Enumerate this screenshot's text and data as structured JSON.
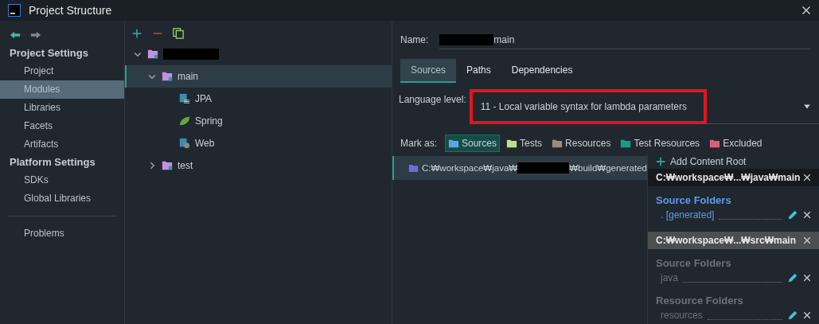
{
  "window": {
    "title": "Project Structure"
  },
  "sidebar": {
    "sections": [
      {
        "title": "Project Settings",
        "items": [
          {
            "label": "Project",
            "selected": false
          },
          {
            "label": "Modules",
            "selected": true
          },
          {
            "label": "Libraries",
            "selected": false
          },
          {
            "label": "Facets",
            "selected": false
          },
          {
            "label": "Artifacts",
            "selected": false
          }
        ]
      },
      {
        "title": "Platform Settings",
        "items": [
          {
            "label": "SDKs",
            "selected": false
          },
          {
            "label": "Global Libraries",
            "selected": false
          }
        ]
      }
    ],
    "bottom_items": [
      {
        "label": "Problems",
        "selected": false
      }
    ]
  },
  "tree": [
    {
      "redacted": true,
      "kind": "module",
      "expanded": true,
      "selected": false,
      "children": [
        {
          "label": "main",
          "kind": "module",
          "expanded": true,
          "selected": true,
          "children": [
            {
              "label": "JPA",
              "kind": "jpa",
              "selected": false
            },
            {
              "label": "Spring",
              "kind": "spring",
              "selected": false
            },
            {
              "label": "Web",
              "kind": "web",
              "selected": false
            }
          ]
        },
        {
          "label": "test",
          "kind": "module",
          "expanded": false,
          "selected": false
        }
      ]
    }
  ],
  "detail": {
    "name_label": "Name:",
    "name_value": "main",
    "name_redacted": true,
    "tabs": [
      {
        "label": "Sources",
        "selected": true
      },
      {
        "label": "Paths",
        "selected": false
      },
      {
        "label": "Dependencies",
        "selected": false
      }
    ],
    "language_level": {
      "label": "Language level:",
      "value": "11 - Local variable syntax for lambda parameters",
      "highlighted": true
    },
    "mark_as": {
      "label": "Mark as:",
      "options": [
        {
          "label": "Sources",
          "kind": "sources",
          "selected": true
        },
        {
          "label": "Tests",
          "kind": "tests",
          "selected": false
        },
        {
          "label": "Resources",
          "kind": "resources",
          "selected": false
        },
        {
          "label": "Test Resources",
          "kind": "test-resources",
          "selected": false
        },
        {
          "label": "Excluded",
          "kind": "excluded",
          "selected": false
        }
      ]
    },
    "source_row": {
      "path_start": "C:₩workspace₩java₩",
      "path_end": "₩build₩generated"
    }
  },
  "content_roots": {
    "add_label": "Add Content Root",
    "roots": [
      {
        "path": "C:₩workspace₩...₩java₩main",
        "active": true,
        "groups": [
          {
            "title": "Source Folders",
            "folders": [
              ". [generated]"
            ]
          }
        ]
      },
      {
        "path": "C:₩workspace₩...₩src₩main",
        "active": false,
        "groups": [
          {
            "title": "Source Folders",
            "folders": [
              "java"
            ]
          },
          {
            "title": "Resource Folders",
            "folders": [
              "resources"
            ]
          }
        ]
      }
    ]
  }
}
